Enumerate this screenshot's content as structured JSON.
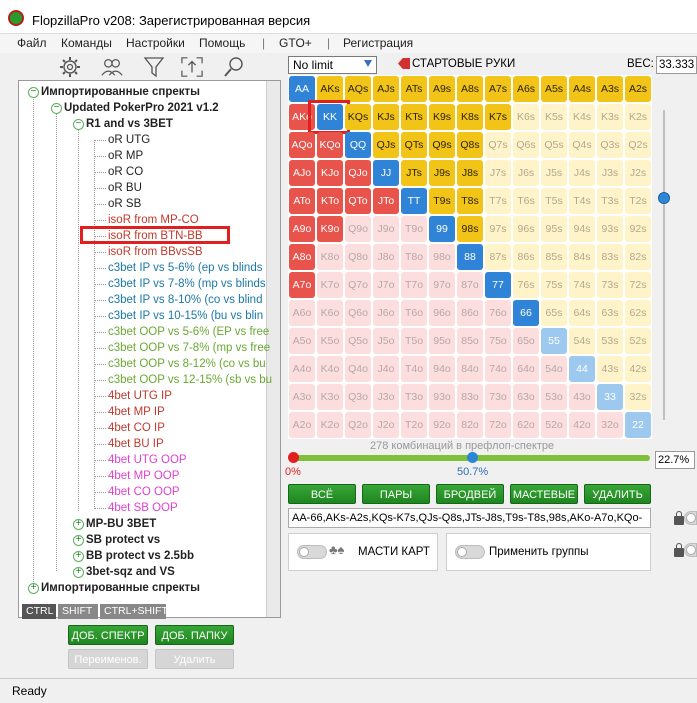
{
  "window": {
    "title": "FlopzillaPro v208: Зарегистрированная версия"
  },
  "menu": [
    "Файл",
    "Команды",
    "Настройки",
    "Помощь",
    "|",
    "GTO+",
    "|",
    "Регистрация"
  ],
  "toolbar_icons": [
    "gear-icon",
    "users-icon",
    "filter-icon",
    "export-icon",
    "search-icon"
  ],
  "tree": [
    {
      "label": "Импортированные спректы",
      "level": 0,
      "toggle": "minus",
      "bold": true,
      "color": "black"
    },
    {
      "label": "Updated PokerPro 2021 v1.2",
      "level": 1,
      "toggle": "minus",
      "bold": true,
      "color": "black"
    },
    {
      "label": "R1 and vs 3BET",
      "level": 2,
      "toggle": "minus",
      "bold": true,
      "color": "black"
    },
    {
      "label": "oR UTG",
      "level": 3,
      "color": "black"
    },
    {
      "label": "oR MP",
      "level": 3,
      "color": "black"
    },
    {
      "label": "oR CO",
      "level": 3,
      "color": "black"
    },
    {
      "label": "oR BU",
      "level": 3,
      "color": "black"
    },
    {
      "label": "oR SB",
      "level": 3,
      "color": "black"
    },
    {
      "label": "isoR from MP-CO",
      "level": 3,
      "color": "red"
    },
    {
      "label": "isoR from BTN-BB",
      "level": 3,
      "color": "red",
      "highlighted": true
    },
    {
      "label": "isoR from BBvsSB",
      "level": 3,
      "color": "red"
    },
    {
      "label": "c3bet IP vs 5-6% (ep vs blinds",
      "level": 3,
      "color": "blue"
    },
    {
      "label": "c3bet IP vs 7-8% (mp vs blinds",
      "level": 3,
      "color": "blue"
    },
    {
      "label": "c3bet IP vs 8-10% (co vs blind",
      "level": 3,
      "color": "blue"
    },
    {
      "label": "c3bet IP vs 10-15% (bu vs blin",
      "level": 3,
      "color": "blue"
    },
    {
      "label": "c3bet OOP vs 5-6% (EP vs free",
      "level": 3,
      "color": "green"
    },
    {
      "label": "c3bet OOP vs 7-8% (mp vs free",
      "level": 3,
      "color": "green"
    },
    {
      "label": "c3bet OOP vs 8-12% (co vs bu",
      "level": 3,
      "color": "green"
    },
    {
      "label": "c3bet OOP vs 12-15% (sb vs bu",
      "level": 3,
      "color": "green"
    },
    {
      "label": "4bet UTG IP",
      "level": 3,
      "color": "red"
    },
    {
      "label": "4bet MP IP",
      "level": 3,
      "color": "red"
    },
    {
      "label": "4bet CO IP",
      "level": 3,
      "color": "red"
    },
    {
      "label": "4bet BU IP",
      "level": 3,
      "color": "red"
    },
    {
      "label": "4bet UTG OOP",
      "level": 3,
      "color": "pink"
    },
    {
      "label": "4bet MP OOP",
      "level": 3,
      "color": "pink"
    },
    {
      "label": "4bet CO OOP",
      "level": 3,
      "color": "pink"
    },
    {
      "label": "4bet SB OOP",
      "level": 3,
      "color": "pink"
    },
    {
      "label": "MP-BU 3BET",
      "level": 2,
      "toggle": "plus",
      "bold": true,
      "color": "black"
    },
    {
      "label": "SB protect vs",
      "level": 2,
      "toggle": "plus",
      "bold": true,
      "color": "black"
    },
    {
      "label": "BB protect vs 2.5bb",
      "level": 2,
      "toggle": "plus",
      "bold": true,
      "color": "black"
    },
    {
      "label": "3bet-sqz and VS",
      "level": 2,
      "toggle": "plus",
      "bold": true,
      "color": "black"
    },
    {
      "label": "Импортированные спректы",
      "level": 0,
      "toggle": "plus",
      "bold": true,
      "color": "black"
    }
  ],
  "modifier_tabs": [
    "CTRL",
    "SHIFT",
    "CTRL+SHIFT"
  ],
  "left_buttons": {
    "add_range": "ДОБ. СПЕКТР",
    "add_folder": "ДОБ. ПАПКУ",
    "rename": "Переименов.",
    "delete": "Удалить"
  },
  "game_type": {
    "value": "No limit"
  },
  "start_hands_label": "СТАРТОВЫЕ РУКИ",
  "weight": {
    "label": "ВЕС:",
    "value": "33.333"
  },
  "ranks": [
    "A",
    "K",
    "Q",
    "J",
    "T",
    "9",
    "8",
    "7",
    "6",
    "5",
    "4",
    "3",
    "2"
  ],
  "selected_hands": [
    "AA",
    "KK",
    "QQ",
    "JJ",
    "TT",
    "99",
    "88",
    "77",
    "66",
    "AKs",
    "AQs",
    "AJs",
    "ATs",
    "A9s",
    "A8s",
    "A7s",
    "A6s",
    "A5s",
    "A4s",
    "A3s",
    "A2s",
    "KQs",
    "KJs",
    "KTs",
    "K9s",
    "K8s",
    "K7s",
    "QJs",
    "QTs",
    "Q9s",
    "Q8s",
    "JTs",
    "J9s",
    "J8s",
    "T9s",
    "T8s",
    "98s",
    "AKo",
    "AQo",
    "AJo",
    "ATo",
    "A9o",
    "A8o",
    "A7o",
    "KQo",
    "KJo",
    "KTo",
    "K9o",
    "QJo",
    "QTo",
    "JTo"
  ],
  "light_pairs": [
    "55",
    "44",
    "33",
    "22"
  ],
  "highlighted_hand": "KK",
  "combo_label": "278 комбинаций в префлоп-спектре",
  "slider": {
    "left_label": "0%",
    "mid_label": "50.7%",
    "mid_value": 0.507,
    "box_value": "22.7%"
  },
  "grid_buttons": [
    "ВСЁ",
    "ПАРЫ",
    "БРОДВЕЙ",
    "МАСТЕВЫЕ",
    "УДАЛИТЬ"
  ],
  "range_text": "AA-66,AKs-A2s,KQs-K7s,QJs-Q8s,JTs-J8s,T9s-T8s,98s,AKo-A7o,KQo-",
  "options": {
    "suits_label": "МАСТИ КАРТ",
    "groups_label": "Применить группы"
  },
  "status": "Ready"
}
